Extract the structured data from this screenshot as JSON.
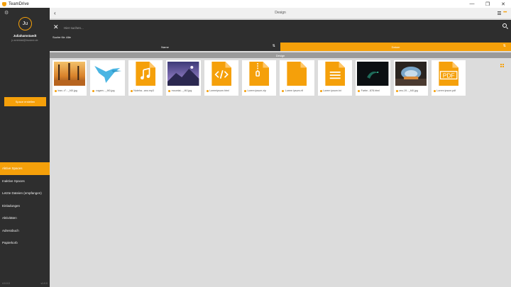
{
  "app": {
    "title": "TeamDrive"
  },
  "window_controls": {
    "minimize": "—",
    "maximize": "❐",
    "close": "✕"
  },
  "sidebar": {
    "avatar_initials": "Ju",
    "user_name": "Juliahamstaedt",
    "user_email": "jr.ambidat@trusted.de",
    "create_space_label": "Space erstellen",
    "items": [
      {
        "label": "Aktive Spaces",
        "active": true
      },
      {
        "label": "Inaktive Spaces",
        "active": false
      },
      {
        "label": "Letzte Dateien (empfangen)",
        "active": false
      },
      {
        "label": "Einladungen",
        "active": false
      },
      {
        "label": "Aktivitäten",
        "active": false
      },
      {
        "label": "Adressbuch",
        "active": false
      },
      {
        "label": "Papierkorb",
        "active": false
      }
    ],
    "footer_left": "4.0.0.0",
    "footer_right": "v1.0.0"
  },
  "main": {
    "title": "Design",
    "search": {
      "placeholder": "Hier suchen...",
      "scope_label": "Suche für: Alle"
    },
    "sort": {
      "name_label": "Name",
      "date_label": "Datum",
      "arrow": "⇅"
    },
    "group_label": "Design",
    "files": [
      {
        "name": "leav..r7..._f40.jpg",
        "kind": "photo-autumn"
      },
      {
        "name": "zugam..._f40.jpg",
        "kind": "photo-bird"
      },
      {
        "name": "Noteha...ano.mp3",
        "kind": "audio"
      },
      {
        "name": "mountai..._f40.jpg",
        "kind": "photo-mountain"
      },
      {
        "name": "Loremipsum.html",
        "kind": "code"
      },
      {
        "name": "Lorem ipsum.zip",
        "kind": "zip"
      },
      {
        "name": "Lorem ipsum.rtf",
        "kind": "blank"
      },
      {
        "name": "Lorem ipsum.txt",
        "kind": "text"
      },
      {
        "name": "Farbe...878.html",
        "kind": "photo-dark"
      },
      {
        "name": "zeo-19..._f40.jpg",
        "kind": "photo-cave"
      },
      {
        "name": "Lorem ipsum.pdf",
        "kind": "pdf"
      }
    ]
  },
  "colors": {
    "accent": "#f5a00a",
    "sidebar": "#2e2e2e",
    "content_bg": "#dcdcdc"
  }
}
